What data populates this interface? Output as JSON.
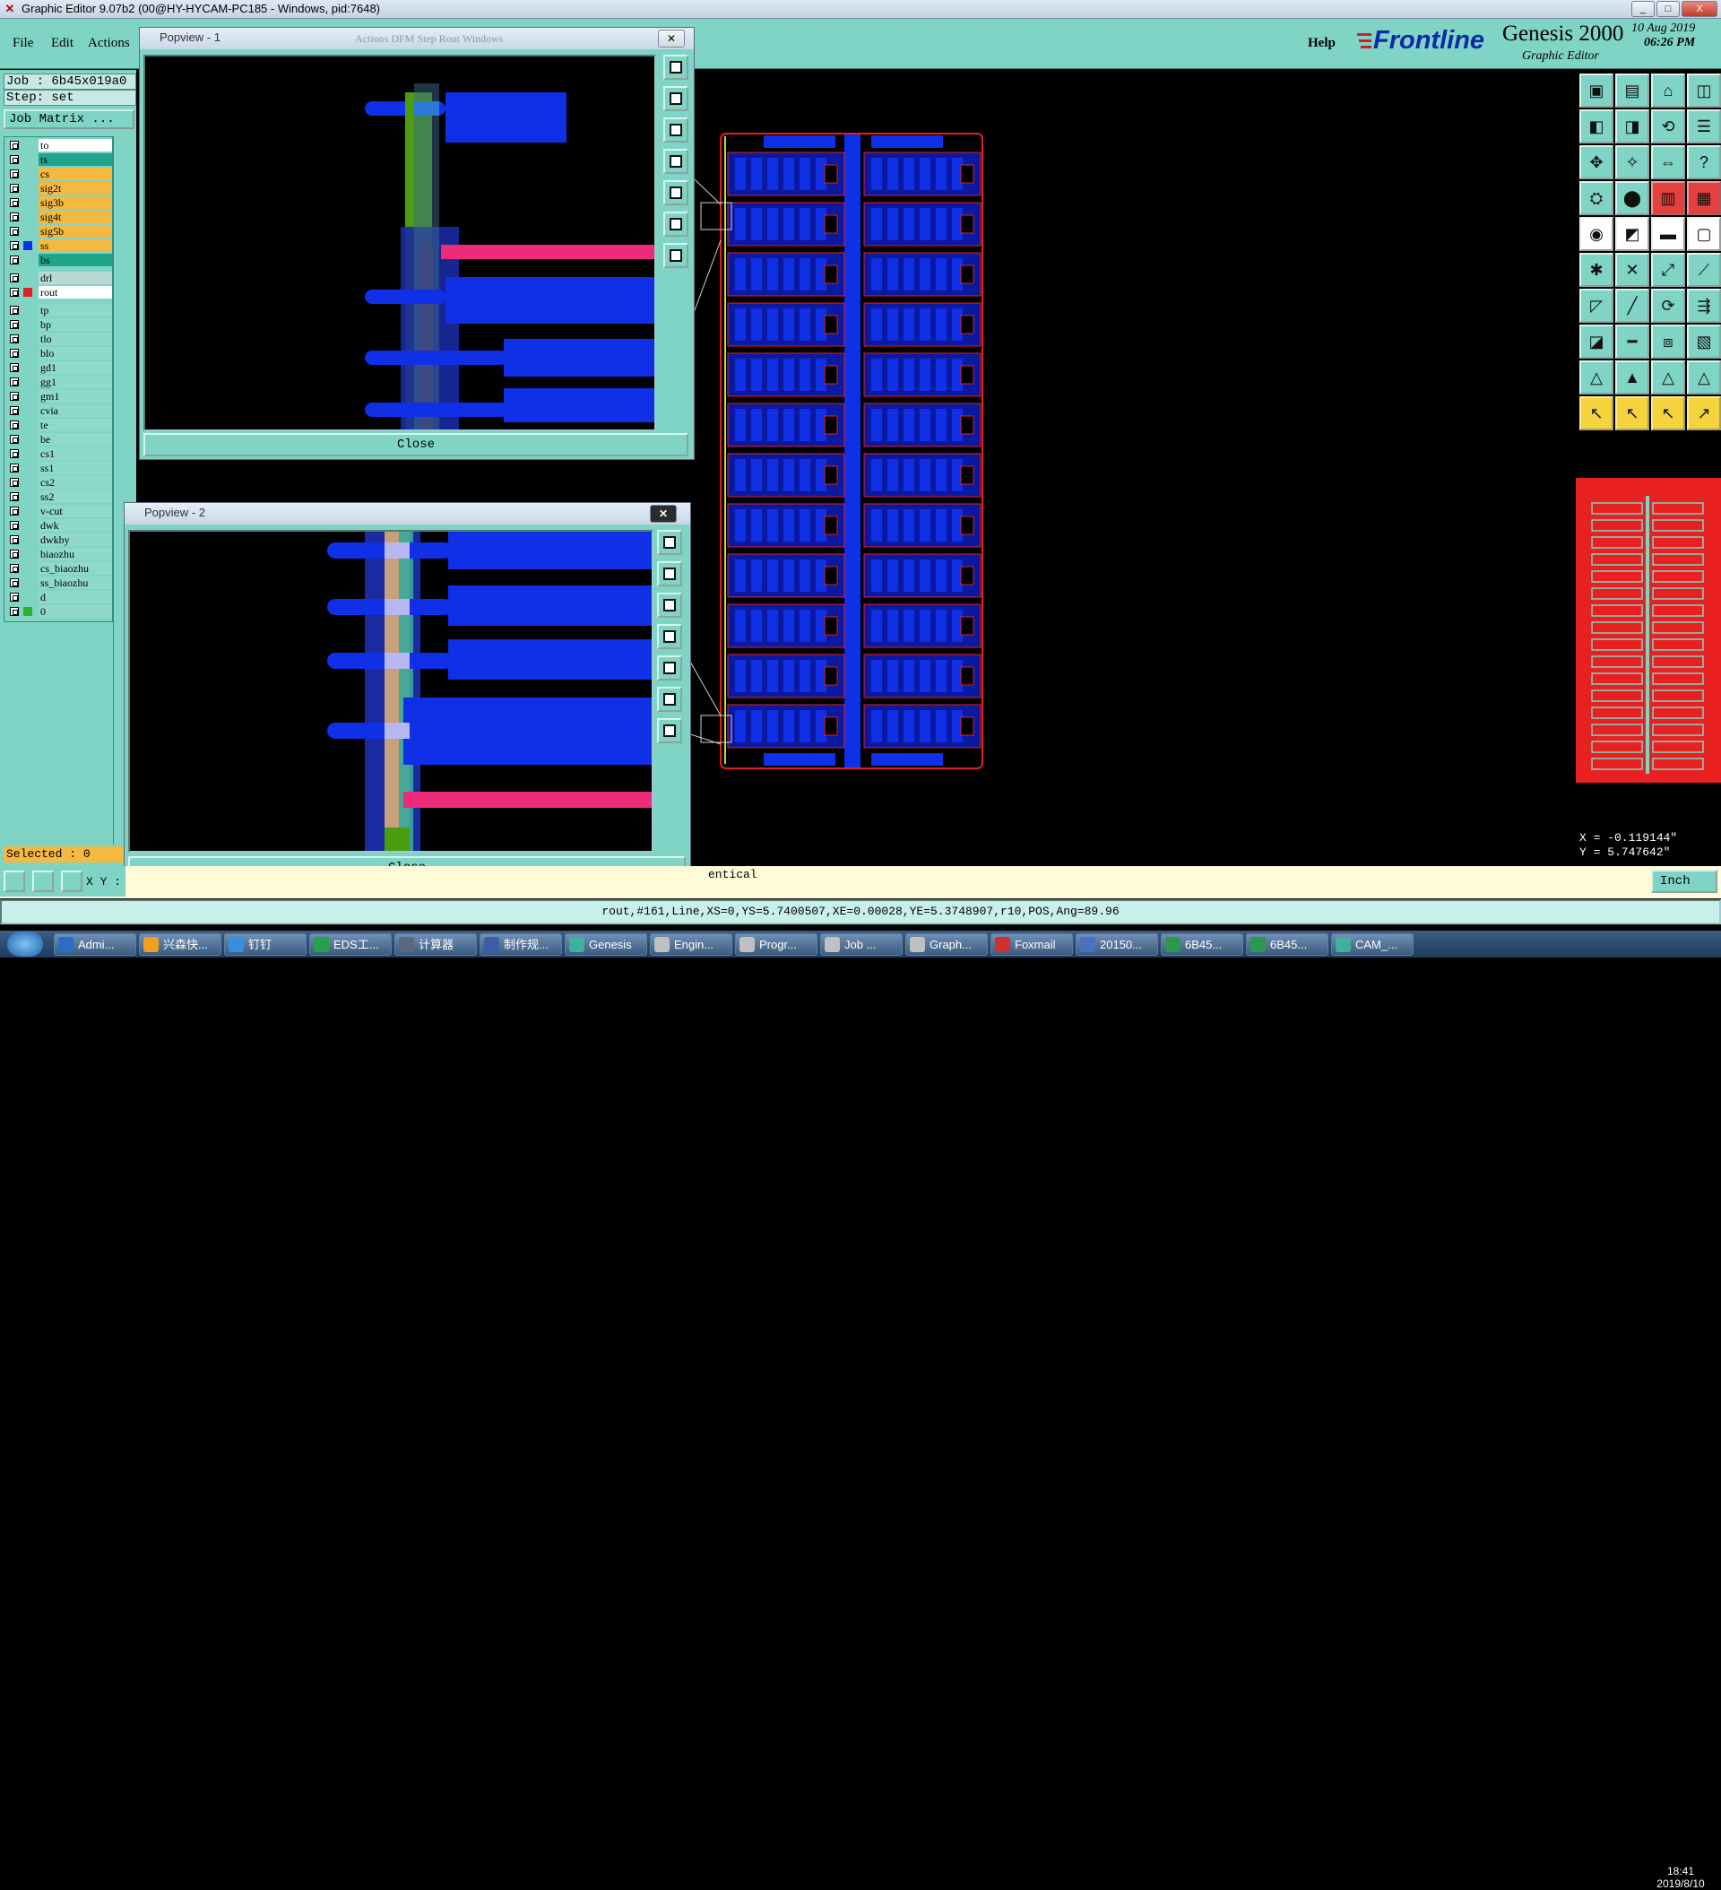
{
  "window": {
    "title": "Graphic Editor 9.07b2 (00@HY-HYCAM-PC185 - Windows, pid:7648)",
    "controls": [
      "_",
      "□",
      "X"
    ]
  },
  "menubar": {
    "file": "File",
    "edit": "Edit",
    "actions": "Actions",
    "help": "Help"
  },
  "brand": {
    "logo": "Frontline",
    "product": "Genesis 2000",
    "subtitle": "Graphic Editor",
    "date": "10 Aug 2019",
    "time": "06:26 PM"
  },
  "job": {
    "job_line": "Job : 6b45x019a0",
    "step_line": "Step: set",
    "job_matrix": "Job Matrix ..."
  },
  "layers": [
    {
      "name": "to",
      "color": "#ffffff",
      "swatch": ""
    },
    {
      "name": "ts",
      "color": "#1fa58c",
      "swatch": ""
    },
    {
      "name": "cs",
      "color": "#f5b942",
      "swatch": ""
    },
    {
      "name": "sig2t",
      "color": "#f5b942",
      "swatch": ""
    },
    {
      "name": "sig3b",
      "color": "#f5b942",
      "swatch": ""
    },
    {
      "name": "sig4t",
      "color": "#f5b942",
      "swatch": ""
    },
    {
      "name": "sig5b",
      "color": "#f5b942",
      "swatch": ""
    },
    {
      "name": "ss",
      "color": "#f5b942",
      "swatch": "#1030e0"
    },
    {
      "name": "bs",
      "color": "#1fa58c",
      "swatch": ""
    },
    {
      "name": "drl",
      "color": "#b9d9d4",
      "swatch": ""
    },
    {
      "name": "rout",
      "color": "#ffffff",
      "swatch": "#e02020"
    },
    {
      "name": "tp",
      "color": "#8fd9cc",
      "swatch": ""
    },
    {
      "name": "bp",
      "color": "#8fd9cc",
      "swatch": ""
    },
    {
      "name": "tlo",
      "color": "#8fd9cc",
      "swatch": ""
    },
    {
      "name": "blo",
      "color": "#8fd9cc",
      "swatch": ""
    },
    {
      "name": "gd1",
      "color": "#8fd9cc",
      "swatch": ""
    },
    {
      "name": "gg1",
      "color": "#8fd9cc",
      "swatch": ""
    },
    {
      "name": "gm1",
      "color": "#8fd9cc",
      "swatch": ""
    },
    {
      "name": "cvia",
      "color": "#8fd9cc",
      "swatch": ""
    },
    {
      "name": "te",
      "color": "#8fd9cc",
      "swatch": ""
    },
    {
      "name": "be",
      "color": "#8fd9cc",
      "swatch": ""
    },
    {
      "name": "cs1",
      "color": "#8fd9cc",
      "swatch": ""
    },
    {
      "name": "ss1",
      "color": "#8fd9cc",
      "swatch": ""
    },
    {
      "name": "cs2",
      "color": "#8fd9cc",
      "swatch": ""
    },
    {
      "name": "ss2",
      "color": "#8fd9cc",
      "swatch": ""
    },
    {
      "name": "v-cut",
      "color": "#8fd9cc",
      "swatch": ""
    },
    {
      "name": "dwk",
      "color": "#8fd9cc",
      "swatch": ""
    },
    {
      "name": "dwkby",
      "color": "#8fd9cc",
      "swatch": ""
    },
    {
      "name": "biaozhu",
      "color": "#8fd9cc",
      "swatch": ""
    },
    {
      "name": "cs_biaozhu",
      "color": "#8fd9cc",
      "swatch": ""
    },
    {
      "name": "ss_biaozhu",
      "color": "#8fd9cc",
      "swatch": ""
    },
    {
      "name": "d",
      "color": "#8fd9cc",
      "swatch": ""
    },
    {
      "name": "0",
      "color": "#8fd9cc",
      "swatch": "#2db32d"
    }
  ],
  "selected_text": "Selected : 0",
  "popview1": {
    "title": "Popview - 1",
    "close_label": "Close",
    "ghost_menu": "Actions  DFM  Step  Rout  Windows"
  },
  "popview2": {
    "title": "Popview - 2",
    "close_label": "Close"
  },
  "command": {
    "xy_label": "X Y :",
    "message": "entical",
    "unit": "Inch"
  },
  "status_line": "rout,#161,Line,XS=0,YS=5.7400507,XE=0.00028,YE=5.3748907,r10,POS,Ang=89.96",
  "coords": {
    "x": "X = -0.119144\"",
    "y": "Y = 5.747642\""
  },
  "taskbar": {
    "items": [
      "Admi...",
      "兴森快...",
      "钉钉",
      "EDS工...",
      "计算器",
      "制作规...",
      "Genesis",
      "Engin...",
      "Progr...",
      "Job ...",
      "Graph...",
      "Foxmail",
      "20150...",
      "6B45...",
      "6B45...",
      "CAM_..."
    ],
    "clock_time": "18:41",
    "clock_date": "2019/8/10"
  },
  "colors": {
    "panel": "#7fd4c5",
    "copper_blue": "#1030e8",
    "rout_red": "#e02020",
    "pad_pink": "#ee2a7b"
  }
}
